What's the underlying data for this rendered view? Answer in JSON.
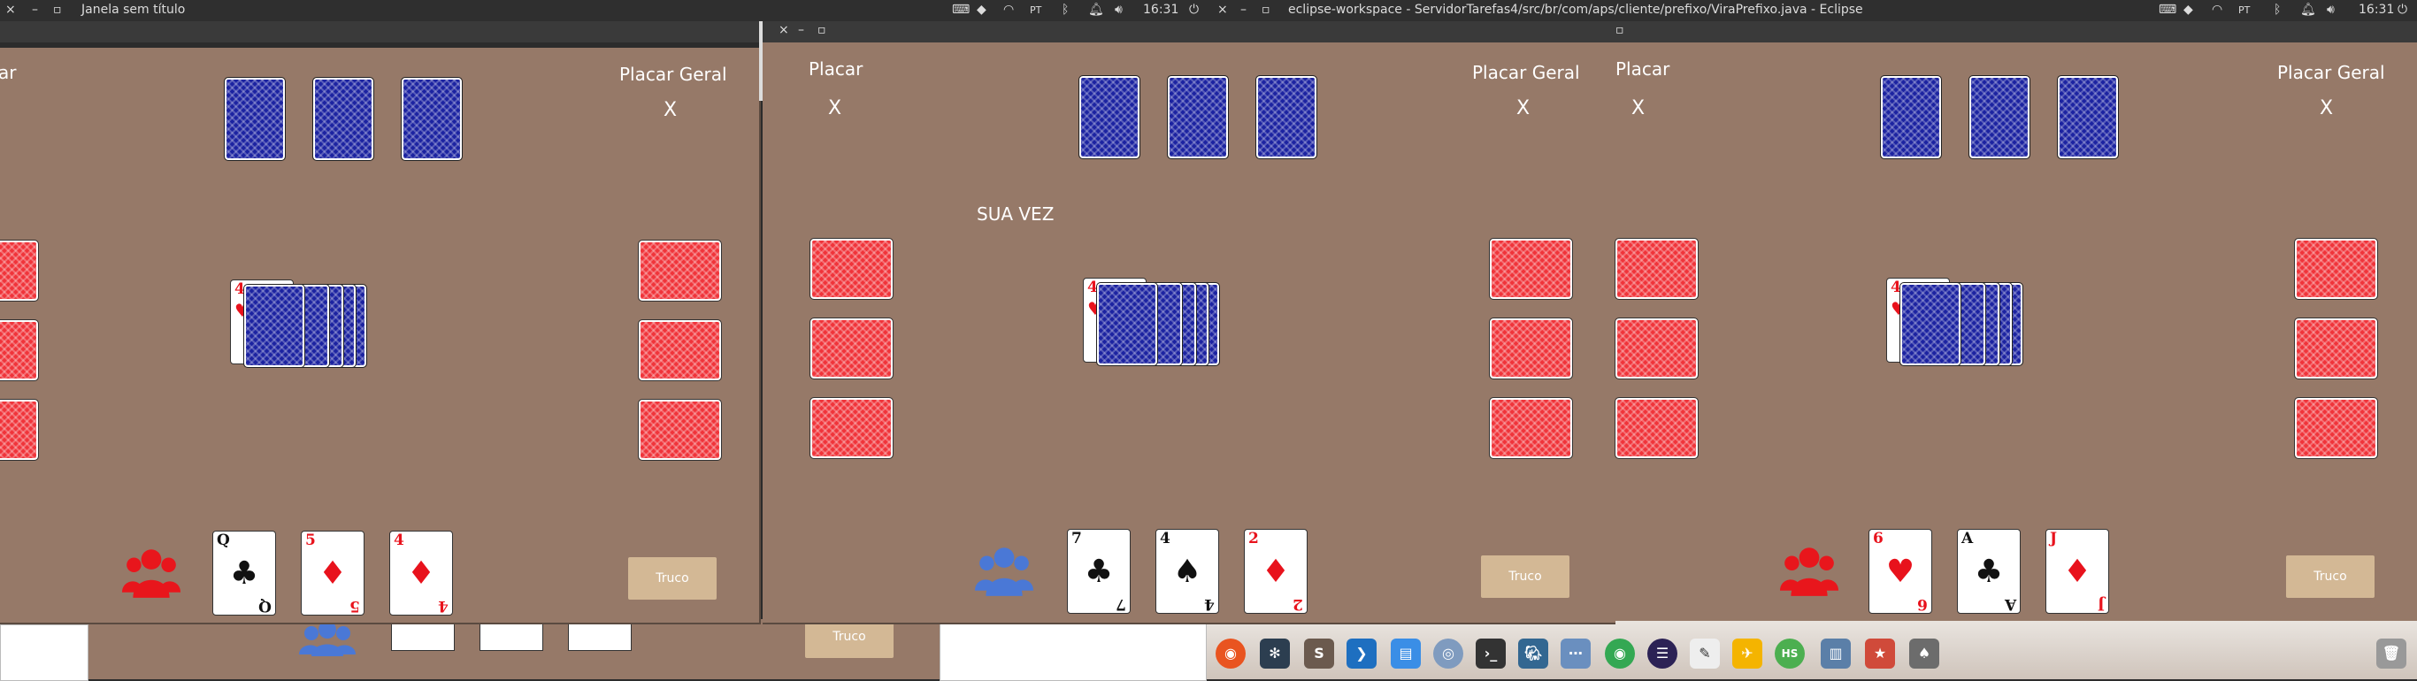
{
  "topbar": {
    "left_title": "Janela sem título",
    "eclipse_title": "eclipse-workspace - ServidorTarefas4/src/br/com/aps/cliente/prefixo/ViraPrefixo.java - Eclipse",
    "time": "16:31",
    "pt_badge": "PT"
  },
  "windows": [
    {
      "placar_label": "ar",
      "placar_score": "",
      "placar_geral_label": "Placar Geral",
      "placar_geral_score": "X",
      "turn_label": "",
      "truco_label": "Truco",
      "vira_card": {
        "rank": "4",
        "suit": "♥",
        "color": "red"
      },
      "hand": [
        {
          "rank": "Q",
          "suit": "♣",
          "color": "black",
          "court": true
        },
        {
          "rank": "5",
          "suit": "♦",
          "color": "red"
        },
        {
          "rank": "4",
          "suit": "♦",
          "color": "red"
        }
      ],
      "player_icon_color": "#e8161c"
    },
    {
      "placar_label": "Placar",
      "placar_score": "X",
      "placar_geral_label": "Placar Geral",
      "placar_geral_score": "X",
      "turn_label": "SUA VEZ",
      "truco_label": "Truco",
      "vira_card": {
        "rank": "4",
        "suit": "♥",
        "color": "red"
      },
      "hand": [
        {
          "rank": "7",
          "suit": "♣",
          "color": "black"
        },
        {
          "rank": "4",
          "suit": "♠",
          "color": "black"
        },
        {
          "rank": "2",
          "suit": "♦",
          "color": "red"
        }
      ],
      "player_icon_color": "#4a78d6"
    },
    {
      "placar_label": "Placar",
      "placar_score": "X",
      "placar_geral_label": "Placar Geral",
      "placar_geral_score": "X",
      "turn_label": "",
      "truco_label": "Truco",
      "vira_card": {
        "rank": "4",
        "suit": "♥",
        "color": "red"
      },
      "hand": [
        {
          "rank": "6",
          "suit": "♥",
          "color": "red"
        },
        {
          "rank": "A",
          "suit": "♣",
          "color": "black"
        },
        {
          "rank": "J",
          "suit": "♦",
          "color": "red",
          "court": true
        }
      ],
      "player_icon_color": "#e8161c"
    }
  ],
  "behind_window": {
    "truco_label": "Truco"
  },
  "dock": {
    "icons": [
      "ubuntu-icon",
      "settings-icon",
      "s-icon",
      "vscode-icon",
      "files-icon",
      "disk-icon",
      "terminal-icon",
      "postgres-icon",
      "dots-icon",
      "chrome-icon",
      "eclipse-icon",
      "edit-icon",
      "bird-icon",
      "hs-icon",
      "notes-icon",
      "star-icon",
      "game-icon",
      "trash-icon"
    ],
    "hs_label": "HS",
    "s_label": "S"
  },
  "colors": {
    "felt": "#967968",
    "blue_back": "#1c23a1",
    "red_back": "#f0343a",
    "truco_button": "#d3b895"
  }
}
